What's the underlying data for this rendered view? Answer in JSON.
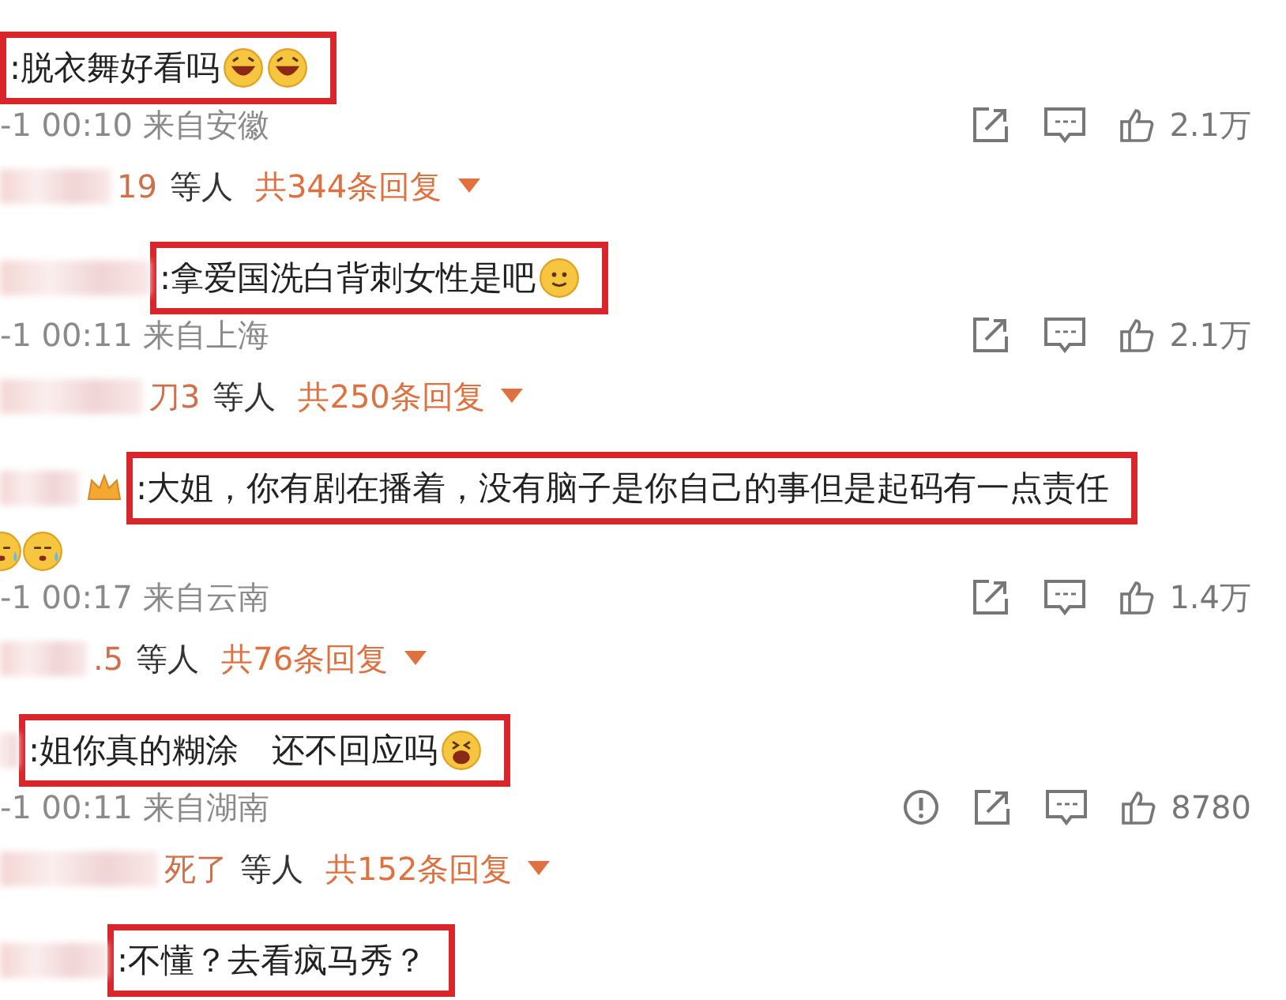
{
  "comments": [
    {
      "text": ":脱衣舞好看吗",
      "emojis": [
        {
          "kind": "laughing"
        },
        {
          "kind": "laughing"
        }
      ],
      "meta": "-1 00:10 来自安徽",
      "likes": "2.1万",
      "replies": {
        "user_fragment": "19",
        "suffix": "等人",
        "count": "共344条回复"
      }
    },
    {
      "text": ":拿爱国洗白背刺女性是吧",
      "emojis": [
        {
          "kind": "smiling"
        }
      ],
      "meta": "-1 00:11 来自上海",
      "likes": "2.1万",
      "replies": {
        "user_fragment": "刀3",
        "suffix": "等人",
        "count": "共250条回复"
      }
    },
    {
      "text": ":大姐，你有剧在播着，没有脑子是你自己的事但是起码有一点责任",
      "has_crown": true,
      "extra_emojis": [
        {
          "kind": "crying"
        },
        {
          "kind": "crying"
        }
      ],
      "meta": "-1 00:17 来自云南",
      "likes": "1.4万",
      "replies": {
        "user_fragment": ".5",
        "suffix": "等人",
        "count": "共76条回复"
      }
    },
    {
      "text": ":姐你真的糊涂　还不回应吗",
      "emojis": [
        {
          "kind": "shouting"
        }
      ],
      "meta": "-1 00:11 来自湖南",
      "reportable": true,
      "likes": "8780",
      "replies": {
        "user_fragment": "死了",
        "suffix": "等人",
        "count": "共152条回复"
      }
    },
    {
      "text": ":不懂？去看疯马秀？"
    }
  ]
}
